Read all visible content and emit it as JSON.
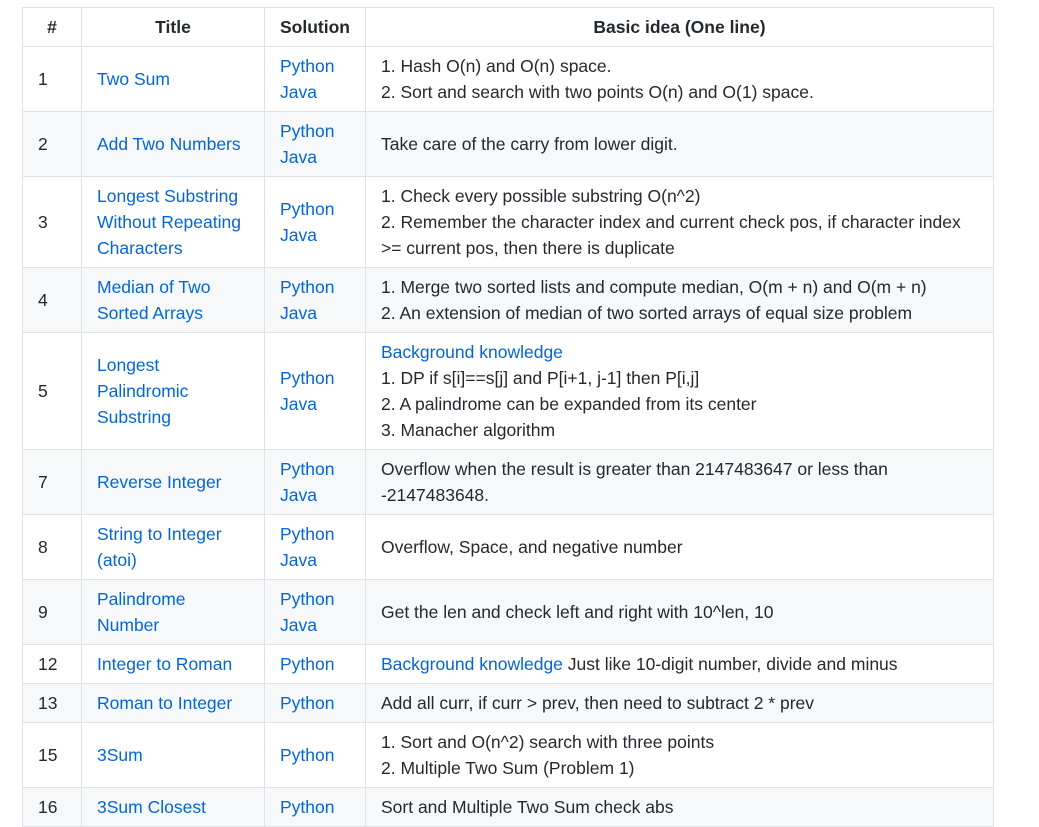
{
  "headers": [
    "#",
    "Title",
    "Solution",
    "Basic idea (One line)"
  ],
  "rows": [
    {
      "num": "1",
      "title": "Two Sum",
      "solutions": [
        "Python",
        "Java"
      ],
      "idea_lines": [
        [
          {
            "text": "1. Hash O(n) and O(n) space."
          }
        ],
        [
          {
            "text": "2. Sort and search with two points O(n) and O(1) space."
          }
        ]
      ]
    },
    {
      "num": "2",
      "title": "Add Two Numbers",
      "solutions": [
        "Python",
        "Java"
      ],
      "idea_lines": [
        [
          {
            "text": "Take care of the carry from lower digit."
          }
        ]
      ]
    },
    {
      "num": "3",
      "title": "Longest Substring Without Repeating Characters",
      "solutions": [
        "Python",
        "Java"
      ],
      "idea_lines": [
        [
          {
            "text": "1. Check every possible substring O(n^2)"
          }
        ],
        [
          {
            "text": "2. Remember the character index and current check pos, if character index >= current pos, then there is duplicate"
          }
        ]
      ]
    },
    {
      "num": "4",
      "title": "Median of Two Sorted Arrays",
      "solutions": [
        "Python",
        "Java"
      ],
      "idea_lines": [
        [
          {
            "text": "1. Merge two sorted lists and compute median, O(m + n) and O(m + n)"
          }
        ],
        [
          {
            "text": "2. An extension of median of two sorted arrays of equal size problem"
          }
        ]
      ]
    },
    {
      "num": "5",
      "title": "Longest Palindromic Substring",
      "solutions": [
        "Python",
        "Java"
      ],
      "idea_lines": [
        [
          {
            "text": "Background knowledge",
            "link": true
          }
        ],
        [
          {
            "text": "1. DP if s[i]==s[j] and P[i+1, j-1] then P[i,j]"
          }
        ],
        [
          {
            "text": "2. A palindrome can be expanded from its center"
          }
        ],
        [
          {
            "text": "3. Manacher algorithm"
          }
        ]
      ]
    },
    {
      "num": "7",
      "title": "Reverse Integer",
      "solutions": [
        "Python",
        "Java"
      ],
      "idea_lines": [
        [
          {
            "text": "Overflow when the result is greater than 2147483647 or less than -2147483648."
          }
        ]
      ]
    },
    {
      "num": "8",
      "title": "String to Integer (atoi)",
      "solutions": [
        "Python",
        "Java"
      ],
      "idea_lines": [
        [
          {
            "text": "Overflow, Space, and negative number"
          }
        ]
      ]
    },
    {
      "num": "9",
      "title": "Palindrome Number",
      "solutions": [
        "Python",
        "Java"
      ],
      "idea_lines": [
        [
          {
            "text": "Get the len and check left and right with 10^len, 10"
          }
        ]
      ]
    },
    {
      "num": "12",
      "title": "Integer to Roman",
      "solutions": [
        "Python"
      ],
      "idea_lines": [
        [
          {
            "text": "Background knowledge",
            "link": true
          },
          {
            "text": " Just like 10-digit number, divide and minus"
          }
        ]
      ]
    },
    {
      "num": "13",
      "title": "Roman to Integer",
      "solutions": [
        "Python"
      ],
      "idea_lines": [
        [
          {
            "text": "Add all curr, if curr > prev, then need to subtract 2 * prev"
          }
        ]
      ]
    },
    {
      "num": "15",
      "title": "3Sum",
      "solutions": [
        "Python"
      ],
      "idea_lines": [
        [
          {
            "text": "1. Sort and O(n^2) search with three points"
          }
        ],
        [
          {
            "text": "2. Multiple Two Sum (Problem 1)"
          }
        ]
      ]
    },
    {
      "num": "16",
      "title": "3Sum Closest",
      "solutions": [
        "Python"
      ],
      "idea_lines": [
        [
          {
            "text": "Sort and Multiple Two Sum check abs"
          }
        ]
      ]
    }
  ]
}
